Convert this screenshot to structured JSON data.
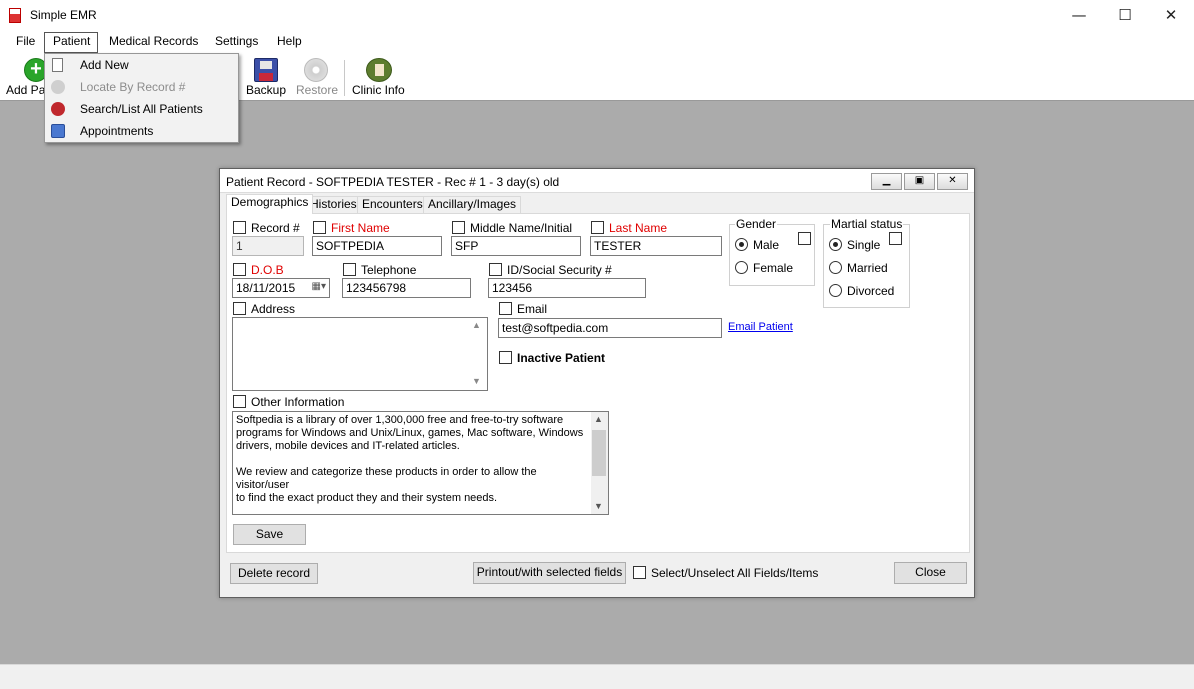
{
  "window": {
    "title": "Simple EMR",
    "minimize": "—",
    "maximize": "☐",
    "close": "✕"
  },
  "menu": {
    "file": "File",
    "patient": "Patient",
    "medical_records": "Medical Records",
    "settings": "Settings",
    "help": "Help"
  },
  "toolbar": {
    "add_patient": "Add Pa",
    "backup": "Backup",
    "restore": "Restore",
    "clinic_info": "Clinic Info"
  },
  "dropdown": {
    "items": [
      {
        "label": "Add New",
        "enabled": true
      },
      {
        "label": "Locate By Record #",
        "enabled": false
      },
      {
        "label": "Search/List All Patients",
        "enabled": true
      },
      {
        "label": "Appointments",
        "enabled": true
      }
    ]
  },
  "dialog": {
    "title": "Patient Record - SOFTPEDIA TESTER - Rec # 1 - 3 day(s) old",
    "tabs": [
      "Demographics",
      "Histories",
      "Encounters",
      "Ancillary/Images"
    ],
    "fields": {
      "record_label": "Record #",
      "record_value": "1",
      "first_name_label": "First Name",
      "first_name_value": "SOFTPEDIA",
      "middle_name_label": "Middle Name/Initial",
      "middle_name_value": "SFP",
      "last_name_label": "Last Name",
      "last_name_value": "TESTER",
      "dob_label": "D.O.B",
      "dob_value": "18/11/2015",
      "telephone_label": "Telephone",
      "telephone_value": "123456798",
      "id_label": "ID/Social Security #",
      "id_value": "123456",
      "address_label": "Address",
      "address_value": "",
      "email_label": "Email",
      "email_value": "test@softpedia.com",
      "email_link": "Email Patient",
      "inactive_label": "Inactive Patient",
      "other_info_label": "Other Information",
      "other_info_line1": "Softpedia is a library of over 1,300,000 free and free-to-try software",
      "other_info_line2": "programs for Windows and Unix/Linux, games, Mac software, Windows",
      "other_info_line3": "drivers, mobile devices and IT-related articles.",
      "other_info_line4": "We review and categorize these products in order to allow the visitor/user",
      "other_info_line5": "to find the exact product they and their system needs."
    },
    "gender": {
      "title": "Gender",
      "options": [
        "Male",
        "Female"
      ],
      "selected": "Male"
    },
    "marital": {
      "title": "Martial status",
      "options": [
        "Single",
        "Married",
        "Divorced"
      ],
      "selected": "Single"
    },
    "buttons": {
      "save": "Save",
      "delete": "Delete record",
      "printout": "Printout/with selected fields",
      "select_all": "Select/Unselect All Fields/Items",
      "close": "Close"
    }
  }
}
